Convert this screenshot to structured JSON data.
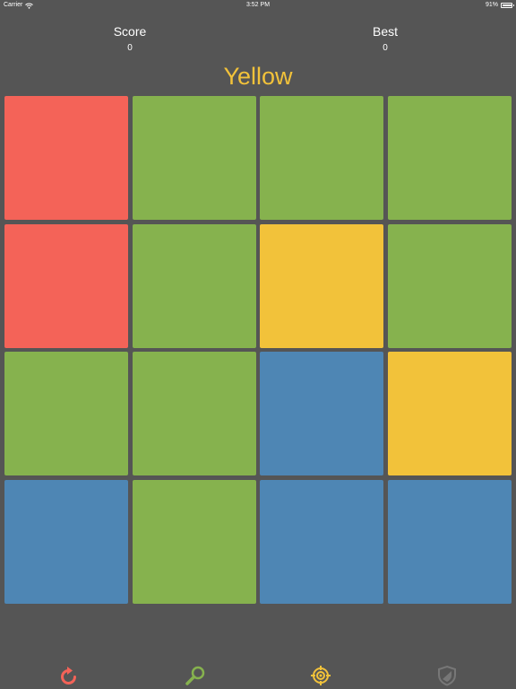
{
  "status_bar": {
    "carrier": "Carrier",
    "time": "3:52 PM",
    "battery": "91%",
    "battery_level": 0.91
  },
  "score": {
    "label": "Score",
    "value": "0"
  },
  "best": {
    "label": "Best",
    "value": "0"
  },
  "target_color": {
    "text": "Yellow",
    "color": "#F2C23A"
  },
  "colors": {
    "background": "#555555",
    "red": "#F46358",
    "green": "#86B24E",
    "yellow": "#F2C23A",
    "blue": "#4E86B4"
  },
  "grid": {
    "rows": [
      [
        "red",
        "green",
        "green",
        "green"
      ],
      [
        "red",
        "green",
        "yellow",
        "green"
      ],
      [
        "green",
        "green",
        "blue",
        "yellow"
      ],
      [
        "blue",
        "green",
        "blue",
        "blue"
      ]
    ]
  },
  "toolbar": {
    "buttons": [
      {
        "name": "restart",
        "icon": "restart-icon",
        "color": "#F46358"
      },
      {
        "name": "hint",
        "icon": "magnifier-icon",
        "color": "#86B24E"
      },
      {
        "name": "target",
        "icon": "crosshair-icon",
        "color": "#F2C23A"
      },
      {
        "name": "shield",
        "icon": "shield-icon",
        "color": "#777777"
      }
    ]
  }
}
